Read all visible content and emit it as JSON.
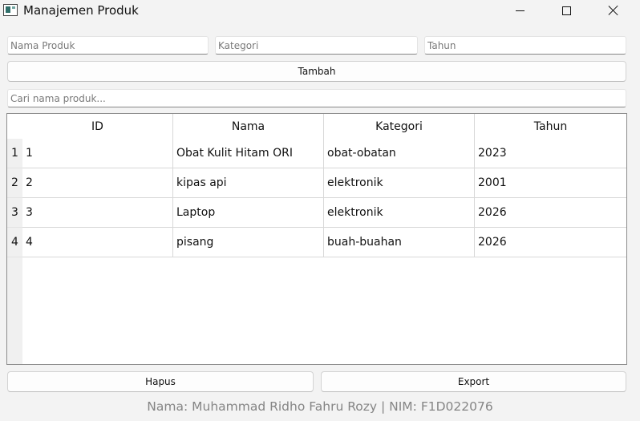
{
  "window": {
    "title": "Manajemen Produk"
  },
  "form": {
    "nama_placeholder": "Nama Produk",
    "kategori_placeholder": "Kategori",
    "tahun_placeholder": "Tahun",
    "tambah_label": "Tambah",
    "search_placeholder": "Cari nama produk..."
  },
  "table": {
    "columns": [
      "ID",
      "Nama",
      "Kategori",
      "Tahun"
    ],
    "rows": [
      {
        "num": "1",
        "cells": [
          "1",
          "Obat Kulit Hitam ORI",
          "obat-obatan",
          "2023"
        ]
      },
      {
        "num": "2",
        "cells": [
          "2",
          "kipas api",
          "elektronik",
          "2001"
        ]
      },
      {
        "num": "3",
        "cells": [
          "3",
          "Laptop",
          "elektronik",
          "2026"
        ]
      },
      {
        "num": "4",
        "cells": [
          "4",
          "pisang",
          "buah-buahan",
          "2026"
        ]
      }
    ]
  },
  "actions": {
    "hapus_label": "Hapus",
    "export_label": "Export"
  },
  "footer": {
    "text": "Nama: Muhammad Ridho Fahru Rozy | NIM: F1D022076"
  },
  "icons": {
    "app": "app-window-icon",
    "minimize": "minimize-icon",
    "maximize": "maximize-icon",
    "close": "close-icon"
  }
}
